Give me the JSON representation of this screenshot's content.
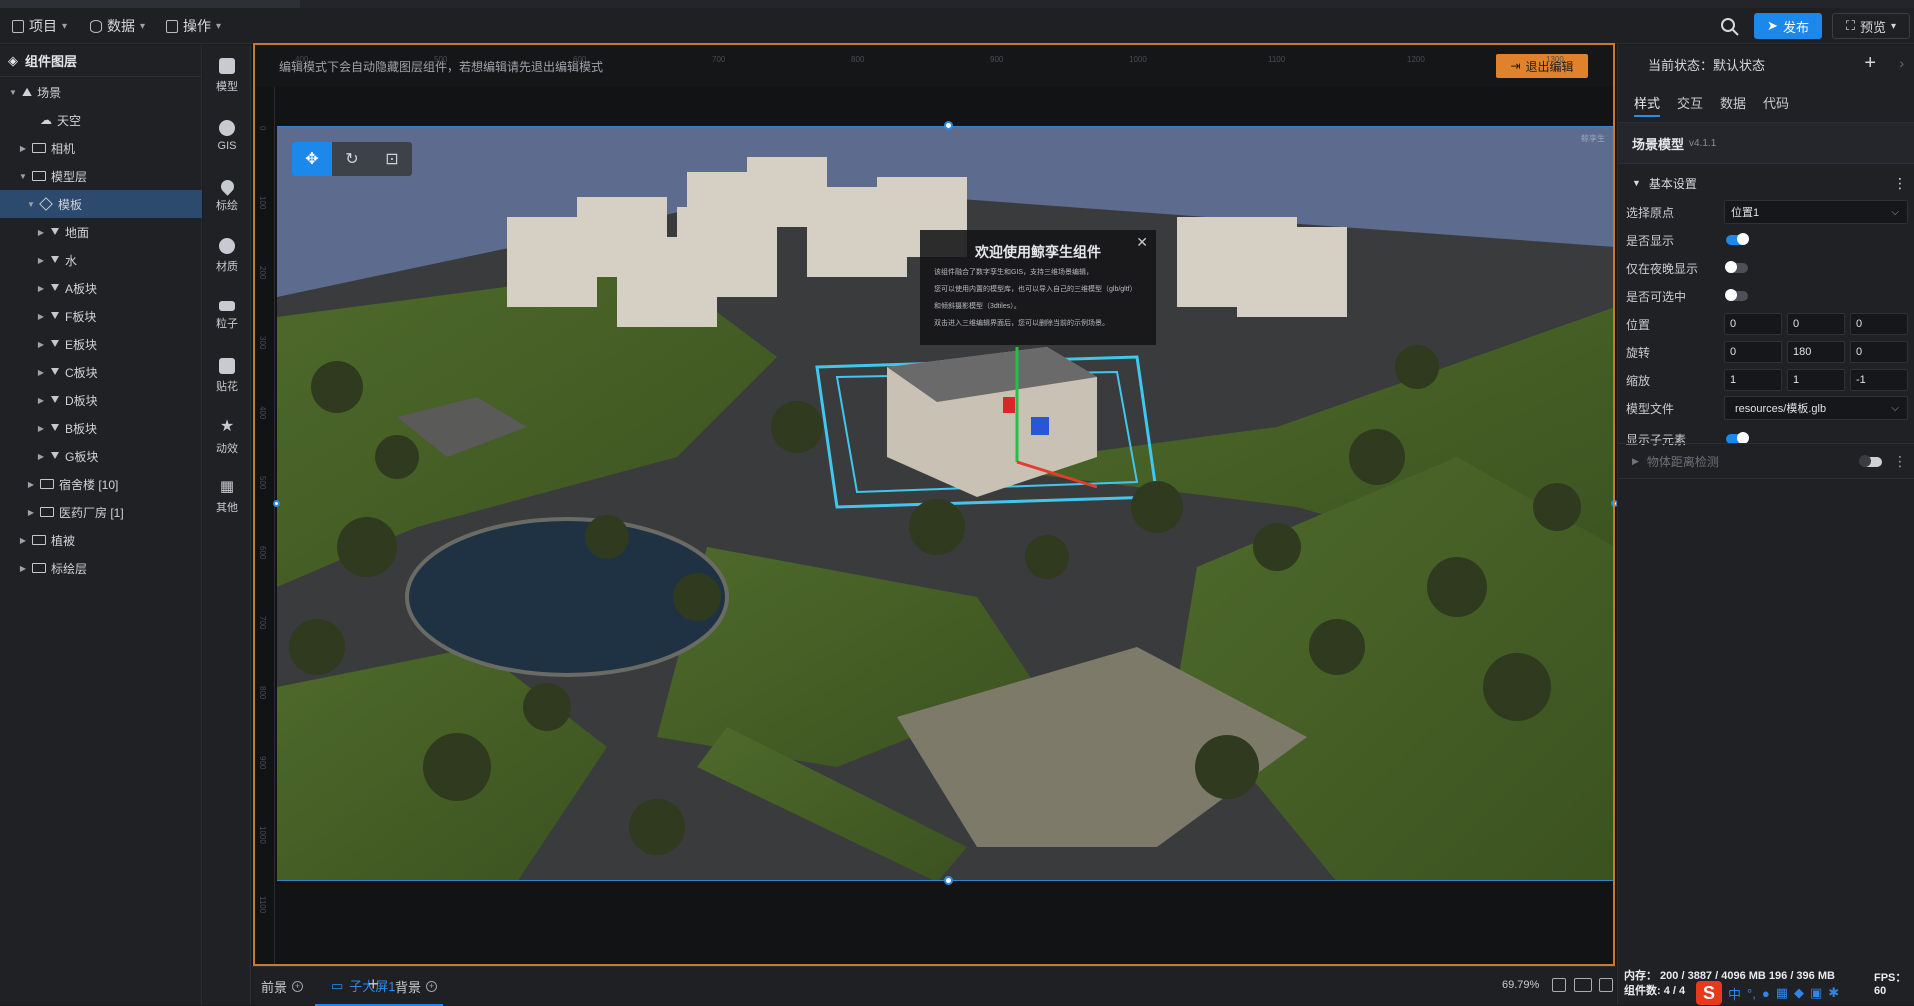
{
  "menus": [
    {
      "label": "项目",
      "icon": "file-icon"
    },
    {
      "label": "数据",
      "icon": "database-icon"
    },
    {
      "label": "操作",
      "icon": "grid-icon"
    }
  ],
  "header": {
    "publish": "发布",
    "preview": "预览"
  },
  "layers": {
    "title": "组件图层",
    "items": [
      {
        "label": "场景"
      },
      {
        "label": "天空"
      },
      {
        "label": "相机"
      },
      {
        "label": "模型层"
      },
      {
        "label": "模板"
      },
      {
        "label": "地面"
      },
      {
        "label": "水"
      },
      {
        "label": "A板块"
      },
      {
        "label": "F板块"
      },
      {
        "label": "E板块"
      },
      {
        "label": "C板块"
      },
      {
        "label": "D板块"
      },
      {
        "label": "B板块"
      },
      {
        "label": "G板块"
      },
      {
        "label": "宿舍楼 [10]"
      },
      {
        "label": "医药厂房 [1]"
      },
      {
        "label": "植被"
      },
      {
        "label": "标绘层"
      }
    ]
  },
  "tools": [
    "模型",
    "GIS",
    "标绘",
    "材质",
    "粒子",
    "贴花",
    "动效",
    "其他"
  ],
  "editor": {
    "notice": "编辑模式下会自动隐藏图层组件，若想编辑请先退出编辑模式",
    "exit": "退出编辑",
    "badge": "鲸孪生"
  },
  "welcome": {
    "title": "欢迎使用鲸孪生组件",
    "lines": [
      "该组件融合了数字孪生和GIS，支持三维场景编辑，",
      "您可以使用内置的模型库，也可以导入自己的三维模型（glb/gltf）",
      "和倾斜摄影模型（3dtiles）。",
      "双击进入三维编辑界面后，您可以删除当前的示例场景。"
    ]
  },
  "bottom": {
    "front": "前景",
    "sub": "子大屏1",
    "add": "+",
    "back": "背景",
    "zoom": "69.79%"
  },
  "props": {
    "state_label": "当前状态：默认状态",
    "tabs": [
      "样式",
      "交互",
      "数据",
      "代码"
    ],
    "title": "场景模型",
    "version": "v4.1.1",
    "section": "基本设置",
    "origin_label": "选择原点",
    "origin_value": "位置1",
    "show_label": "是否显示",
    "show": true,
    "night_label": "仅在夜晚显示",
    "night": false,
    "selectable_label": "是否可选中",
    "selectable": false,
    "position_label": "位置",
    "position": [
      "0",
      "0",
      "0"
    ],
    "rotation_label": "旋转",
    "rotation": [
      "0",
      "180",
      "0"
    ],
    "scale_label": "缩放",
    "scale": [
      "1",
      "1",
      "-1"
    ],
    "file_label": "模型文件",
    "file_value": "resources/模板.glb",
    "children_label": "显示子元素",
    "children": true,
    "section2": "物体距离检测"
  },
  "status": {
    "memory": "内存： 200 / 3887 / 4096 MB 196 / 396 MB",
    "components": "组件数: 4 / 4",
    "fps": "FPS： 60"
  },
  "colors": {
    "accent": "#1c88ec",
    "exit": "#e0822c",
    "frame": "#c77b2b"
  }
}
